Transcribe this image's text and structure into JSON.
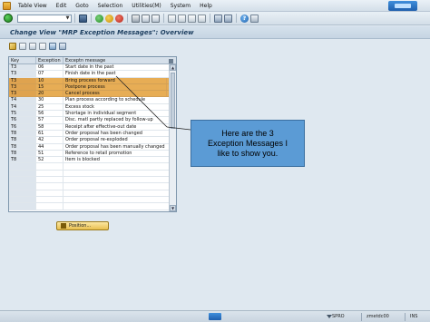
{
  "menu": {
    "items": [
      "Table View",
      "Edit",
      "Goto",
      "Selection",
      "Utilities(M)",
      "System",
      "Help"
    ]
  },
  "toolbar": {
    "command_field_value": "",
    "icons": [
      "ok-icon",
      "save-icon",
      "back-icon",
      "exit-icon",
      "cancel-icon",
      "print-icon",
      "find-icon",
      "find-next-icon",
      "first-page-icon",
      "prev-page-icon",
      "next-page-icon",
      "last-page-icon",
      "new-session-icon",
      "shortcut-icon",
      "help-icon",
      "layout-icon"
    ]
  },
  "title": "Change View \"MRP Exception Messages\": Overview",
  "table": {
    "columns": [
      "Key",
      "Exception",
      "Exceptn message"
    ],
    "rows": [
      {
        "key": "T3",
        "exception": "06",
        "message": "Start date in the past",
        "highlighted": false
      },
      {
        "key": "T3",
        "exception": "07",
        "message": "Finish date in the past",
        "highlighted": false
      },
      {
        "key": "T3",
        "exception": "10",
        "message": "Bring process forward",
        "highlighted": true
      },
      {
        "key": "T3",
        "exception": "15",
        "message": "Postpone process",
        "highlighted": true
      },
      {
        "key": "T3",
        "exception": "20",
        "message": "Cancel process",
        "highlighted": true
      },
      {
        "key": "T4",
        "exception": "30",
        "message": "Plan process according to schedule",
        "highlighted": false
      },
      {
        "key": "T4",
        "exception": "25",
        "message": "Excess stock",
        "highlighted": false
      },
      {
        "key": "T5",
        "exception": "56",
        "message": "Shortage in individual segment",
        "highlighted": false
      },
      {
        "key": "T6",
        "exception": "57",
        "message": "Disc. matl partly replaced by follow-up",
        "highlighted": false
      },
      {
        "key": "T6",
        "exception": "58",
        "message": "Receipt after effective-out date",
        "highlighted": false
      },
      {
        "key": "T8",
        "exception": "61",
        "message": "Order proposal has been changed",
        "highlighted": false
      },
      {
        "key": "T8",
        "exception": "42",
        "message": "Order proposal re-exploded",
        "highlighted": false
      },
      {
        "key": "T8",
        "exception": "44",
        "message": "Order proposal has been manually changed",
        "highlighted": false
      },
      {
        "key": "T8",
        "exception": "51",
        "message": "Reference to retail promotion",
        "highlighted": false
      },
      {
        "key": "T8",
        "exception": "52",
        "message": "Item is blocked",
        "highlighted": false
      },
      {
        "key": "",
        "exception": "",
        "message": "",
        "highlighted": false
      },
      {
        "key": "",
        "exception": "",
        "message": "",
        "highlighted": false
      },
      {
        "key": "",
        "exception": "",
        "message": "",
        "highlighted": false
      },
      {
        "key": "",
        "exception": "",
        "message": "",
        "highlighted": false
      },
      {
        "key": "",
        "exception": "",
        "message": "",
        "highlighted": false
      },
      {
        "key": "",
        "exception": "",
        "message": "",
        "highlighted": false
      },
      {
        "key": "",
        "exception": "",
        "message": "",
        "highlighted": false
      }
    ]
  },
  "position_button": {
    "label": "Position..."
  },
  "callout": {
    "line1": "Here are the 3",
    "line2": "Exception Messages I",
    "line3": "like to show you."
  },
  "status": {
    "system": "SPRO",
    "host": "zmetdc00",
    "mode": "INS"
  },
  "colors": {
    "highlight": "#e7ad55",
    "callout": "#5b9bd5",
    "title_text": "#1e3f60"
  }
}
